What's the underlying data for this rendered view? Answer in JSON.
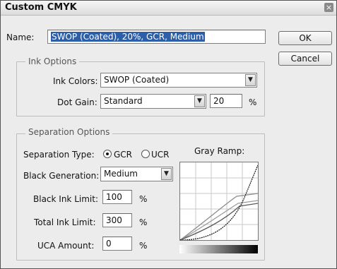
{
  "window": {
    "title": "Custom CMYK",
    "close_glyph": "×"
  },
  "name_field": {
    "label": "Name:",
    "value": "SWOP (Coated), 20%, GCR, Medium"
  },
  "buttons": {
    "ok": "OK",
    "cancel": "Cancel"
  },
  "ink_options": {
    "title": "Ink Options",
    "ink_colors_label": "Ink Colors:",
    "ink_colors_value": "SWOP (Coated)",
    "dot_gain_label": "Dot Gain:",
    "dot_gain_value": "Standard",
    "dot_gain_percent": "20",
    "percent_sign": "%"
  },
  "separation_options": {
    "title": "Separation Options",
    "type_label": "Separation Type:",
    "gcr_label": "GCR",
    "ucr_label": "UCR",
    "selected_type": "GCR",
    "black_gen_label": "Black Generation:",
    "black_gen_value": "Medium",
    "black_ink_limit_label": "Black Ink Limit:",
    "black_ink_limit_value": "100",
    "total_ink_limit_label": "Total Ink Limit:",
    "total_ink_limit_value": "300",
    "uca_amount_label": "UCA Amount:",
    "uca_amount_value": "0",
    "percent_sign": "%",
    "gray_ramp_label": "Gray Ramp:"
  },
  "icons": {
    "dropdown_arrow": "chevron-down-icon",
    "close": "close-icon"
  }
}
